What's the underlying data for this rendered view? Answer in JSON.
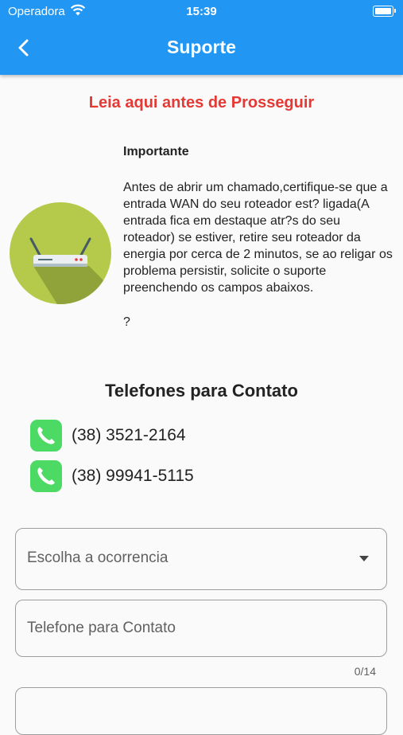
{
  "status_bar": {
    "carrier": "Operadora",
    "time": "15:39"
  },
  "app_bar": {
    "title": "Suporte"
  },
  "warning": "Leia aqui antes de Prosseguir",
  "info": {
    "heading": "Importante",
    "body": "Antes de abrir um chamado,certifique-se que a entrada WAN do seu roteador est? ligada(A entrada fica em destaque atr?s do seu roteador) se estiver, retire seu roteador da energia por cerca de 2 minutos, se ao religar os problema persistir, solicite o suporte preenchendo os campos abaixos.",
    "trailing": "?"
  },
  "phones": {
    "title": "Telefones para Contato",
    "items": [
      {
        "number": "(38) 3521-2164"
      },
      {
        "number": "(38) 99941-5115"
      }
    ]
  },
  "form": {
    "occurrence": {
      "label": "Escolha a ocorrencia"
    },
    "phone_field": {
      "label": "Telefone para Contato",
      "counter": "0/14"
    }
  },
  "colors": {
    "app_bar": "#2196f3",
    "warning": "#e53935",
    "phone_icon": "#4cd964",
    "router_circle": "#b5c94a"
  }
}
